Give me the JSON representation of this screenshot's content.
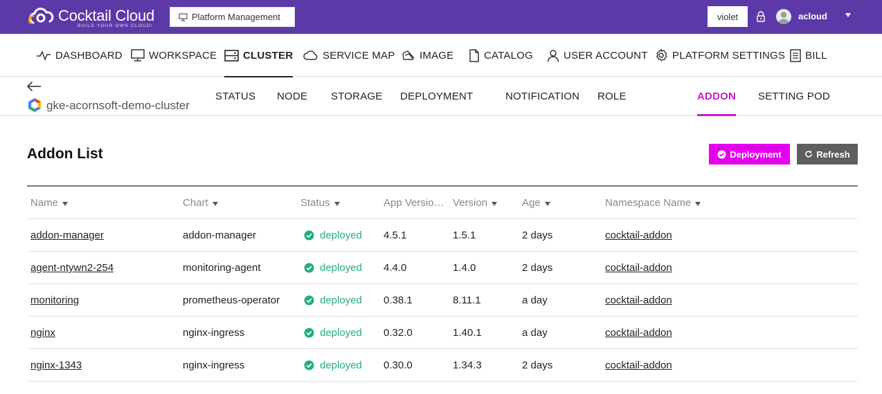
{
  "brand": {
    "name": "Cocktail Cloud",
    "tagline": "BUILD YOUR OWN CLOUD!"
  },
  "topbar": {
    "platform_button": "Platform Management",
    "account_chip": "violet",
    "username": "acloud"
  },
  "colors": {
    "topbar": "#5b3aa7",
    "accent": "#c41ec8",
    "deploy": "#e400ef",
    "refresh": "#5e5e5e",
    "deployed": "#22b07a"
  },
  "nav": {
    "items": [
      {
        "label": "DASHBOARD",
        "icon": "pulse-icon"
      },
      {
        "label": "WORKSPACE",
        "icon": "monitor-icon"
      },
      {
        "label": "CLUSTER",
        "icon": "server-icon",
        "active": true
      },
      {
        "label": "SERVICE MAP",
        "icon": "cloud-icon"
      },
      {
        "label": "IMAGE",
        "icon": "image-icon"
      },
      {
        "label": "CATALOG",
        "icon": "document-icon"
      },
      {
        "label": "USER ACCOUNT",
        "icon": "user-icon"
      },
      {
        "label": "PLATFORM SETTINGS",
        "icon": "gear-icon"
      },
      {
        "label": "BILL",
        "icon": "receipt-icon"
      }
    ]
  },
  "cluster": {
    "name": "gke-acornsoft-demo-cluster"
  },
  "subnav": {
    "items": [
      {
        "label": "STATUS"
      },
      {
        "label": "NODE"
      },
      {
        "label": "STORAGE"
      },
      {
        "label": "DEPLOYMENT"
      },
      {
        "label": "NOTIFICATION"
      },
      {
        "label": "ROLE"
      },
      {
        "label": "ADDON",
        "active": true
      },
      {
        "label": "SETTING POD"
      }
    ]
  },
  "page": {
    "title": "Addon List",
    "deploy_button": "Deployment",
    "refresh_button": "Refresh"
  },
  "table": {
    "columns": [
      "Name",
      "Chart",
      "Status",
      "App Versio…",
      "Version",
      "Age",
      "Namespace Name"
    ],
    "rows": [
      {
        "name": "addon-manager",
        "chart": "addon-manager",
        "status": "deployed",
        "app_version": "4.5.1",
        "version": "1.5.1",
        "age": "2 days",
        "namespace": "cocktail-addon"
      },
      {
        "name": "agent-ntywn2-254",
        "chart": "monitoring-agent",
        "status": "deployed",
        "app_version": "4.4.0",
        "version": "1.4.0",
        "age": "2 days",
        "namespace": "cocktail-addon"
      },
      {
        "name": "monitoring",
        "chart": "prometheus-operator",
        "status": "deployed",
        "app_version": "0.38.1",
        "version": "8.11.1",
        "age": "a day",
        "namespace": "cocktail-addon"
      },
      {
        "name": "nginx",
        "chart": "nginx-ingress",
        "status": "deployed",
        "app_version": "0.32.0",
        "version": "1.40.1",
        "age": "a day",
        "namespace": "cocktail-addon"
      },
      {
        "name": "nginx-1343",
        "chart": "nginx-ingress",
        "status": "deployed",
        "app_version": "0.30.0",
        "version": "1.34.3",
        "age": "2 days",
        "namespace": "cocktail-addon"
      }
    ]
  }
}
